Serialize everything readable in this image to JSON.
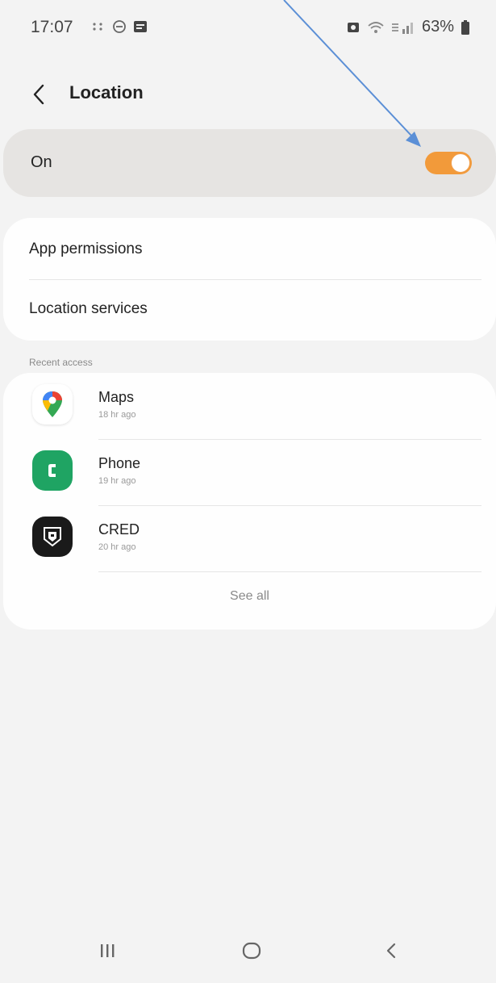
{
  "status_bar": {
    "time": "17:07",
    "battery": "63%"
  },
  "header": {
    "title": "Location"
  },
  "location_toggle": {
    "label": "On",
    "state": "on"
  },
  "settings": {
    "items": [
      {
        "label": "App permissions"
      },
      {
        "label": "Location services"
      }
    ]
  },
  "recent_access": {
    "heading": "Recent access",
    "apps": [
      {
        "name": "Maps",
        "time": "18 hr ago",
        "icon": "maps-icon"
      },
      {
        "name": "Phone",
        "time": "19 hr ago",
        "icon": "phone-icon"
      },
      {
        "name": "CRED",
        "time": "20 hr ago",
        "icon": "cred-icon"
      }
    ],
    "see_all": "See all"
  },
  "navigation": {
    "buttons": [
      "recents",
      "home",
      "back"
    ]
  },
  "colors": {
    "accent": "#f29a3a",
    "background": "#f3f3f3",
    "phone_green": "#1fa463",
    "annotation": "#5b8fd6"
  }
}
